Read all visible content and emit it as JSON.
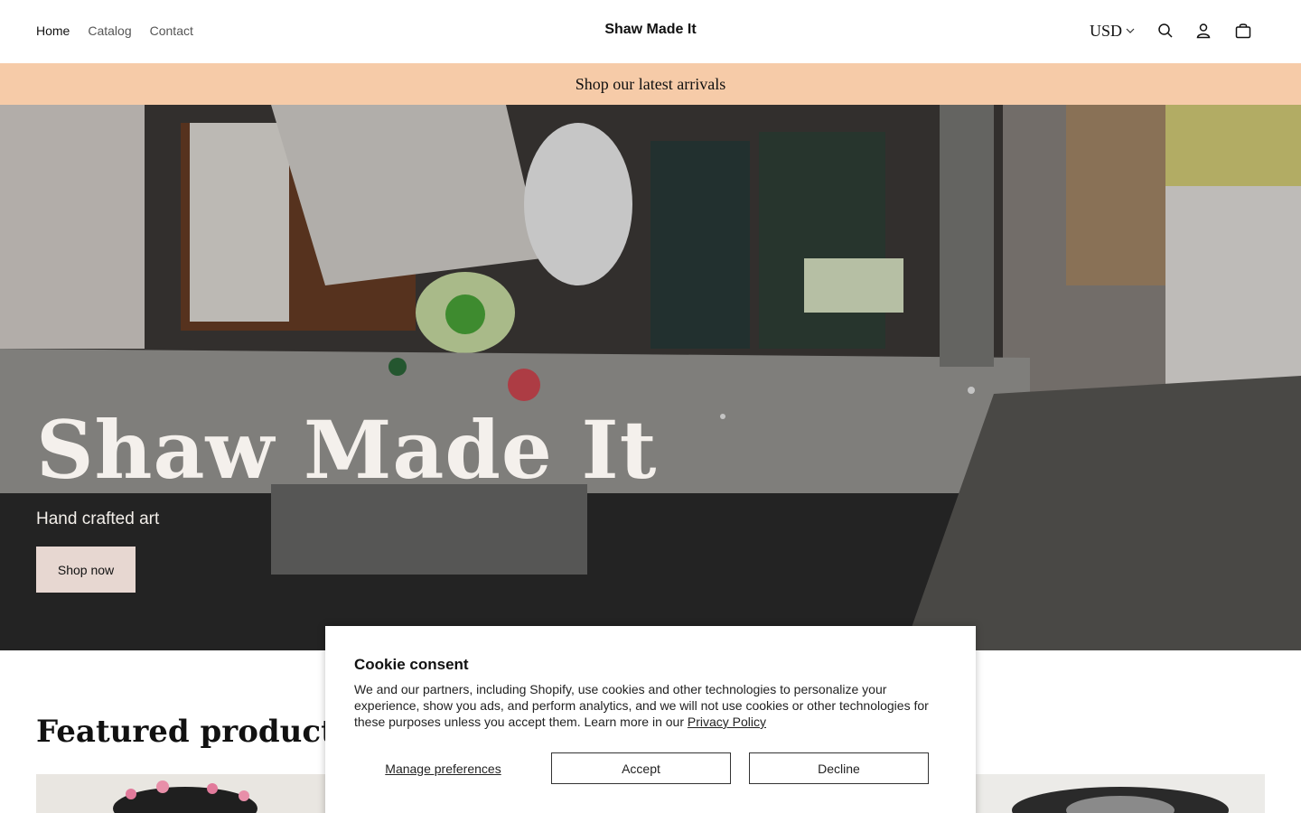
{
  "header": {
    "nav": [
      {
        "label": "Home"
      },
      {
        "label": "Catalog"
      },
      {
        "label": "Contact"
      }
    ],
    "brand": "Shaw Made It",
    "currency": "USD",
    "icons": [
      "search-icon",
      "account-icon",
      "cart-icon"
    ]
  },
  "announcement": "Shop our latest arrivals",
  "hero": {
    "title": "Shaw Made It",
    "subtitle": "Hand crafted art",
    "button": "Shop now"
  },
  "featured": {
    "title": "Featured products"
  },
  "cookie": {
    "title": "Cookie consent",
    "text": "We and our partners, including Shopify, use cookies and other technologies to personalize your experience, show you ads, and perform analytics, and we will not use cookies or other technologies for these purposes unless you accept them. Learn more in our ",
    "link": "Privacy Policy",
    "manage": "Manage preferences",
    "accept": "Accept",
    "decline": "Decline"
  },
  "colors": {
    "announcement_bg": "#f6cba8",
    "hero_button_bg": "#e7d7d1"
  }
}
